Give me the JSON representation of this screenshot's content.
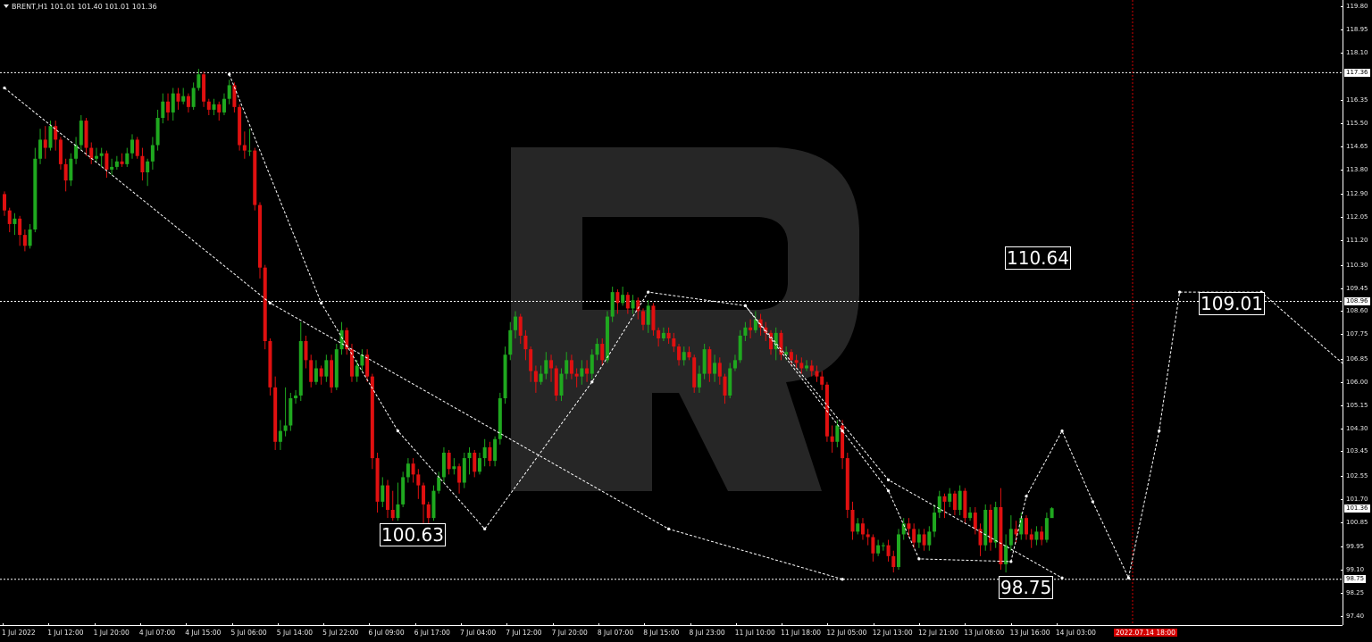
{
  "window": {
    "symbol_title": "BRENT,H1  101.01 101.40 101.01 101.36",
    "colors": {
      "background": "#000000",
      "bull": "#1fa81f",
      "bear": "#e01010",
      "grid_dotted": "#ffffff",
      "now_line": "#d40000",
      "watermark": "#262626"
    }
  },
  "watermark": {
    "icon": "roboforex-r-logo-icon"
  },
  "annotations": {
    "level_110_64": "110.64",
    "level_109_01": "109.01",
    "level_100_63": "100.63",
    "level_98_75": "98.75"
  },
  "axis": {
    "y_ticks": [
      "119.80",
      "118.95",
      "118.10",
      "116.35",
      "115.50",
      "114.65",
      "113.80",
      "112.90",
      "112.05",
      "111.20",
      "110.30",
      "109.45",
      "108.60",
      "107.75",
      "106.85",
      "106.00",
      "105.15",
      "104.30",
      "103.45",
      "102.55",
      "101.70",
      "100.85",
      "99.95",
      "99.10",
      "98.25",
      "97.40"
    ],
    "x_ticks": [
      "1 Jul 2022",
      "1 Jul 12:00",
      "1 Jul 20:00",
      "4 Jul 07:00",
      "4 Jul 15:00",
      "5 Jul 06:00",
      "5 Jul 14:00",
      "5 Jul 22:00",
      "6 Jul 09:00",
      "6 Jul 17:00",
      "7 Jul 04:00",
      "7 Jul 12:00",
      "7 Jul 20:00",
      "8 Jul 07:00",
      "8 Jul 15:00",
      "8 Jul 23:00",
      "11 Jul 10:00",
      "11 Jul 18:00",
      "12 Jul 05:00",
      "12 Jul 13:00",
      "12 Jul 21:00",
      "13 Jul 08:00",
      "13 Jul 16:00",
      "14 Jul 03:00"
    ],
    "now_label": "2022.07.14 18:00",
    "price_tags": {
      "high": "117.36",
      "mid": "108.96",
      "current": "101.36",
      "low": "98.75"
    }
  },
  "chart_data": {
    "type": "candlestick",
    "symbol": "BRENT",
    "timeframe": "H1",
    "ylim": [
      97.2,
      119.9
    ],
    "horizontal_levels": [
      117.36,
      108.96,
      98.75
    ],
    "candles": [
      [
        112.9,
        112.3,
        113.0,
        112.1
      ],
      [
        112.3,
        111.8,
        112.4,
        111.5
      ],
      [
        111.8,
        112.0,
        112.2,
        111.4
      ],
      [
        112.0,
        111.4,
        112.1,
        111.0
      ],
      [
        111.4,
        111.0,
        111.6,
        110.8
      ],
      [
        111.0,
        111.6,
        111.8,
        110.9
      ],
      [
        111.6,
        114.2,
        114.6,
        111.5
      ],
      [
        114.2,
        114.9,
        115.3,
        114.0
      ],
      [
        114.9,
        114.6,
        115.4,
        114.2
      ],
      [
        114.6,
        115.4,
        115.6,
        114.5
      ],
      [
        115.4,
        114.9,
        115.6,
        114.5
      ],
      [
        114.9,
        114.0,
        115.0,
        113.8
      ],
      [
        114.0,
        113.4,
        114.2,
        113.0
      ],
      [
        113.4,
        114.2,
        114.4,
        113.2
      ],
      [
        114.2,
        114.7,
        115.0,
        114.0
      ],
      [
        114.7,
        115.6,
        115.8,
        114.5
      ],
      [
        115.6,
        114.6,
        115.7,
        114.3
      ],
      [
        114.6,
        114.2,
        114.8,
        114.0
      ],
      [
        114.2,
        114.3,
        114.6,
        114.1
      ],
      [
        114.3,
        114.4,
        114.6,
        113.9
      ],
      [
        114.4,
        113.8,
        114.5,
        113.5
      ],
      [
        113.8,
        113.9,
        114.2,
        113.6
      ],
      [
        113.9,
        114.1,
        114.3,
        113.8
      ],
      [
        114.1,
        114.0,
        114.4,
        113.9
      ],
      [
        114.0,
        114.4,
        114.6,
        113.9
      ],
      [
        114.4,
        114.9,
        115.1,
        114.2
      ],
      [
        114.9,
        114.3,
        115.0,
        114.2
      ],
      [
        114.3,
        113.7,
        114.6,
        113.4
      ],
      [
        113.7,
        114.1,
        114.2,
        113.2
      ],
      [
        114.1,
        114.7,
        115.0,
        113.8
      ],
      [
        114.7,
        115.7,
        116.0,
        114.5
      ],
      [
        115.7,
        116.3,
        116.6,
        115.5
      ],
      [
        116.3,
        115.9,
        116.6,
        115.6
      ],
      [
        115.9,
        116.6,
        116.8,
        115.6
      ],
      [
        116.6,
        116.3,
        116.8,
        116.0
      ],
      [
        116.3,
        116.5,
        116.8,
        116.2
      ],
      [
        116.5,
        116.1,
        116.6,
        115.9
      ],
      [
        116.1,
        116.8,
        117.0,
        116.0
      ],
      [
        116.8,
        117.3,
        117.5,
        116.7
      ],
      [
        117.3,
        116.3,
        117.4,
        116.1
      ],
      [
        116.3,
        116.0,
        116.4,
        115.8
      ],
      [
        116.0,
        116.2,
        116.4,
        115.8
      ],
      [
        116.2,
        115.9,
        116.3,
        115.6
      ],
      [
        115.9,
        116.4,
        116.6,
        115.8
      ],
      [
        116.4,
        116.9,
        117.1,
        116.2
      ],
      [
        116.9,
        116.1,
        117.0,
        115.9
      ],
      [
        116.1,
        114.7,
        116.2,
        114.5
      ],
      [
        114.7,
        114.5,
        115.2,
        114.2
      ],
      [
        114.5,
        114.5,
        115.3,
        114.3
      ],
      [
        114.5,
        112.5,
        114.6,
        112.3
      ],
      [
        112.5,
        110.2,
        112.6,
        109.8
      ],
      [
        110.2,
        107.5,
        110.3,
        107.2
      ],
      [
        107.5,
        105.8,
        107.6,
        105.5
      ],
      [
        105.8,
        103.8,
        106.2,
        103.5
      ],
      [
        103.8,
        104.2,
        104.6,
        103.5
      ],
      [
        104.2,
        104.4,
        105.8,
        104.0
      ],
      [
        104.4,
        105.4,
        105.6,
        104.2
      ],
      [
        105.4,
        105.5,
        105.7,
        105.2
      ],
      [
        105.5,
        107.5,
        108.2,
        105.3
      ],
      [
        107.5,
        106.8,
        107.7,
        106.5
      ],
      [
        106.8,
        106.0,
        107.0,
        105.8
      ],
      [
        106.0,
        106.5,
        106.8,
        105.9
      ],
      [
        106.5,
        106.2,
        106.6,
        105.9
      ],
      [
        106.2,
        106.8,
        107.0,
        106.0
      ],
      [
        106.8,
        105.8,
        107.0,
        105.6
      ],
      [
        105.8,
        107.2,
        107.4,
        105.7
      ],
      [
        107.2,
        107.9,
        108.2,
        107.0
      ],
      [
        107.9,
        107.2,
        108.0,
        107.0
      ],
      [
        107.2,
        106.2,
        107.4,
        106.0
      ],
      [
        106.2,
        106.6,
        106.8,
        106.0
      ],
      [
        106.6,
        107.0,
        107.2,
        106.4
      ],
      [
        107.0,
        106.2,
        107.2,
        106.0
      ],
      [
        106.2,
        103.2,
        106.3,
        102.8
      ],
      [
        103.2,
        101.6,
        103.4,
        101.2
      ],
      [
        101.6,
        102.2,
        102.5,
        101.4
      ],
      [
        102.2,
        101.3,
        102.4,
        101.0
      ],
      [
        101.3,
        101.0,
        102.0,
        100.9
      ],
      [
        101.0,
        101.5,
        102.3,
        100.9
      ],
      [
        101.5,
        102.5,
        102.7,
        101.4
      ],
      [
        102.5,
        103.0,
        103.2,
        102.3
      ],
      [
        103.0,
        102.6,
        103.2,
        102.3
      ],
      [
        102.6,
        102.2,
        102.8,
        101.7
      ],
      [
        102.2,
        101.5,
        102.3,
        100.8
      ],
      [
        101.5,
        101.0,
        101.6,
        100.6
      ],
      [
        101.0,
        102.0,
        102.2,
        100.9
      ],
      [
        102.0,
        102.5,
        102.7,
        101.9
      ],
      [
        102.5,
        103.4,
        103.6,
        102.3
      ],
      [
        103.4,
        102.8,
        103.5,
        102.6
      ],
      [
        102.8,
        102.9,
        103.2,
        102.6
      ],
      [
        102.9,
        102.3,
        103.0,
        101.9
      ],
      [
        102.3,
        103.2,
        103.4,
        102.1
      ],
      [
        103.2,
        103.4,
        103.6,
        102.6
      ],
      [
        103.4,
        102.7,
        103.5,
        102.5
      ],
      [
        102.7,
        103.2,
        103.4,
        102.6
      ],
      [
        103.2,
        103.6,
        103.9,
        102.9
      ],
      [
        103.6,
        103.1,
        103.8,
        102.9
      ],
      [
        103.1,
        103.9,
        104.0,
        102.9
      ],
      [
        103.9,
        105.4,
        105.6,
        103.7
      ],
      [
        105.4,
        107.0,
        107.3,
        105.2
      ],
      [
        107.0,
        107.9,
        108.2,
        106.8
      ],
      [
        107.9,
        108.4,
        108.6,
        107.6
      ],
      [
        108.4,
        107.7,
        108.5,
        107.4
      ],
      [
        107.7,
        107.2,
        107.9,
        106.8
      ],
      [
        107.2,
        106.4,
        107.3,
        106.0
      ],
      [
        106.4,
        106.0,
        106.6,
        105.6
      ],
      [
        106.0,
        106.3,
        106.6,
        105.9
      ],
      [
        106.3,
        106.8,
        107.1,
        106.1
      ],
      [
        106.8,
        106.5,
        107.0,
        106.0
      ],
      [
        106.5,
        105.5,
        106.6,
        105.3
      ],
      [
        105.5,
        106.3,
        106.5,
        105.3
      ],
      [
        106.3,
        106.8,
        107.1,
        106.1
      ],
      [
        106.8,
        106.3,
        107.0,
        106.1
      ],
      [
        106.3,
        106.2,
        106.5,
        105.8
      ],
      [
        106.2,
        106.5,
        106.8,
        105.9
      ],
      [
        106.5,
        106.3,
        106.8,
        106.0
      ],
      [
        106.3,
        107.0,
        107.2,
        106.1
      ],
      [
        107.0,
        107.4,
        107.6,
        106.8
      ],
      [
        107.4,
        106.8,
        107.6,
        106.6
      ],
      [
        106.8,
        108.4,
        108.6,
        106.7
      ],
      [
        108.4,
        109.3,
        109.5,
        108.2
      ],
      [
        109.3,
        108.9,
        109.4,
        108.5
      ],
      [
        108.9,
        109.2,
        109.5,
        108.8
      ],
      [
        109.2,
        108.7,
        109.3,
        108.5
      ],
      [
        108.7,
        109.0,
        109.2,
        108.5
      ],
      [
        109.0,
        108.6,
        109.1,
        108.3
      ],
      [
        108.6,
        108.1,
        108.7,
        107.9
      ],
      [
        108.1,
        108.8,
        109.0,
        107.8
      ],
      [
        108.8,
        107.9,
        108.9,
        107.7
      ],
      [
        107.9,
        107.6,
        108.0,
        107.3
      ],
      [
        107.6,
        107.8,
        108.0,
        107.5
      ],
      [
        107.8,
        107.6,
        108.0,
        107.4
      ],
      [
        107.6,
        107.3,
        107.8,
        107.1
      ],
      [
        107.3,
        106.8,
        107.4,
        106.6
      ],
      [
        106.8,
        107.1,
        107.3,
        106.6
      ],
      [
        107.1,
        106.9,
        107.3,
        106.8
      ],
      [
        106.9,
        105.8,
        107.0,
        105.6
      ],
      [
        105.8,
        106.3,
        106.6,
        105.6
      ],
      [
        106.3,
        107.2,
        107.4,
        106.1
      ],
      [
        107.2,
        106.3,
        107.3,
        106.0
      ],
      [
        106.3,
        106.7,
        107.0,
        106.0
      ],
      [
        106.7,
        106.2,
        106.9,
        105.9
      ],
      [
        106.2,
        105.5,
        106.3,
        105.2
      ],
      [
        105.5,
        106.5,
        106.7,
        105.4
      ],
      [
        106.5,
        106.8,
        107.0,
        106.4
      ],
      [
        106.8,
        107.7,
        107.9,
        106.7
      ],
      [
        107.7,
        108.0,
        108.2,
        107.5
      ],
      [
        108.0,
        107.9,
        108.3,
        107.6
      ],
      [
        107.9,
        108.3,
        108.6,
        107.8
      ],
      [
        108.3,
        108.0,
        108.5,
        107.7
      ],
      [
        108.0,
        107.8,
        108.2,
        107.5
      ],
      [
        107.8,
        107.2,
        107.9,
        107.0
      ],
      [
        107.2,
        107.8,
        108.0,
        106.8
      ],
      [
        107.8,
        107.0,
        107.9,
        106.8
      ],
      [
        107.0,
        107.1,
        107.3,
        106.8
      ],
      [
        107.1,
        106.8,
        107.2,
        106.6
      ],
      [
        106.8,
        106.7,
        107.0,
        106.5
      ],
      [
        106.7,
        106.5,
        106.9,
        106.3
      ],
      [
        106.5,
        106.6,
        106.8,
        106.4
      ],
      [
        106.6,
        106.4,
        106.8,
        106.2
      ],
      [
        106.4,
        106.2,
        106.6,
        106.0
      ],
      [
        106.2,
        105.9,
        106.4,
        105.7
      ],
      [
        105.9,
        104.0,
        106.0,
        103.8
      ],
      [
        104.0,
        103.8,
        104.4,
        103.4
      ],
      [
        103.8,
        104.4,
        104.6,
        103.6
      ],
      [
        104.4,
        103.2,
        104.6,
        102.8
      ],
      [
        103.2,
        101.3,
        103.4,
        101.0
      ],
      [
        101.3,
        100.5,
        101.6,
        100.2
      ],
      [
        100.5,
        100.8,
        101.0,
        100.4
      ],
      [
        100.8,
        100.4,
        101.0,
        100.2
      ],
      [
        100.4,
        100.3,
        100.6,
        100.0
      ],
      [
        100.3,
        99.7,
        100.4,
        99.4
      ],
      [
        99.7,
        100.0,
        100.2,
        99.6
      ],
      [
        100.0,
        100.0,
        100.1,
        99.8
      ],
      [
        100.0,
        99.6,
        100.2,
        99.4
      ],
      [
        99.6,
        99.2,
        99.8,
        99.0
      ],
      [
        99.2,
        100.4,
        100.6,
        99.1
      ],
      [
        100.4,
        100.8,
        101.0,
        100.2
      ],
      [
        100.8,
        100.6,
        101.0,
        100.3
      ],
      [
        100.6,
        100.1,
        100.8,
        99.9
      ],
      [
        100.1,
        100.4,
        100.6,
        99.9
      ],
      [
        100.4,
        100.0,
        100.6,
        99.8
      ],
      [
        100.0,
        100.5,
        100.7,
        99.8
      ],
      [
        100.5,
        101.2,
        101.5,
        100.3
      ],
      [
        101.2,
        101.8,
        102.0,
        101.0
      ],
      [
        101.8,
        101.6,
        101.9,
        101.0
      ],
      [
        101.6,
        101.9,
        102.1,
        101.4
      ],
      [
        101.9,
        101.3,
        102.0,
        101.1
      ],
      [
        101.3,
        102.0,
        102.2,
        101.1
      ],
      [
        102.0,
        101.0,
        102.1,
        100.8
      ],
      [
        101.0,
        101.2,
        101.4,
        100.9
      ],
      [
        101.2,
        100.6,
        101.4,
        100.4
      ],
      [
        100.6,
        100.0,
        100.8,
        99.6
      ],
      [
        100.0,
        101.3,
        101.5,
        99.8
      ],
      [
        101.3,
        100.1,
        101.5,
        99.8
      ],
      [
        100.1,
        101.4,
        101.6,
        99.9
      ],
      [
        101.4,
        99.3,
        102.1,
        99.1
      ],
      [
        99.3,
        100.0,
        100.4,
        99.0
      ],
      [
        100.0,
        100.6,
        101.1,
        99.8
      ],
      [
        100.6,
        100.4,
        100.9,
        100.1
      ],
      [
        100.4,
        101.0,
        101.2,
        100.2
      ],
      [
        101.0,
        100.4,
        101.1,
        100.2
      ],
      [
        100.4,
        100.2,
        100.6,
        99.9
      ],
      [
        100.2,
        100.5,
        100.7,
        100.0
      ],
      [
        100.5,
        100.2,
        100.7,
        100.0
      ],
      [
        100.2,
        101.0,
        101.2,
        100.1
      ],
      [
        101.0,
        101.36,
        101.4,
        101.01
      ]
    ],
    "wave_main": [
      [
        0,
        116.8
      ],
      [
        52,
        108.9
      ],
      [
        130,
        100.6
      ],
      [
        164,
        98.75
      ]
    ],
    "wave_zigzag": [
      [
        44,
        117.3
      ],
      [
        62,
        108.9
      ],
      [
        77,
        104.2
      ],
      [
        94,
        100.6
      ],
      [
        115,
        106.0
      ],
      [
        126,
        109.3
      ],
      [
        145,
        108.8
      ],
      [
        164,
        104.2
      ],
      [
        173,
        102.0
      ],
      [
        179,
        99.5
      ],
      [
        197,
        99.4
      ],
      [
        200,
        101.8
      ],
      [
        207,
        104.2
      ],
      [
        213,
        101.6
      ],
      [
        220,
        98.8
      ],
      [
        226,
        104.2
      ],
      [
        230,
        109.3
      ],
      [
        246,
        109.3
      ],
      [
        263,
        106.5
      ]
    ],
    "wave_upper_channel": [
      [
        145,
        108.8
      ],
      [
        173,
        102.4
      ],
      [
        207,
        98.8
      ]
    ],
    "now_index": 220.8
  }
}
